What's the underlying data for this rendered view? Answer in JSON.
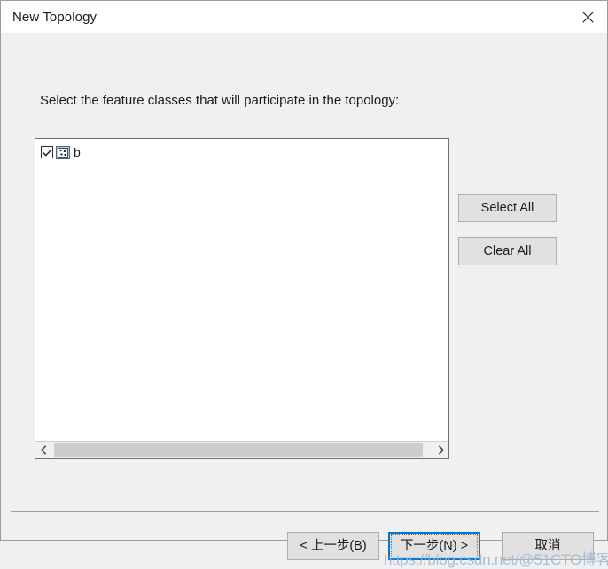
{
  "window": {
    "title": "New Topology",
    "close_icon": "close-icon"
  },
  "main": {
    "instruction": "Select the feature classes that will participate in the topology:",
    "list": {
      "items": [
        {
          "label": "b",
          "checked": true,
          "icon": "feature-class-point-icon"
        }
      ],
      "scrollbar": {
        "left_arrow": "chevron-left-icon",
        "right_arrow": "chevron-right-icon"
      }
    },
    "side_buttons": [
      {
        "label": "Select All",
        "name": "select-all-button"
      },
      {
        "label": "Clear All",
        "name": "clear-all-button"
      }
    ]
  },
  "footer": {
    "back_label": "< 上一步(B)",
    "next_label": "下一步(N) >",
    "cancel_label": "取消"
  },
  "watermark": {
    "text": "https://blog.csdn.net/@51CTO博客"
  },
  "colors": {
    "accent": "#0078d7",
    "dialog_bg": "#f0f0f0",
    "button_bg": "#e1e1e1",
    "list_bg": "#ffffff",
    "border": "#6e7079"
  }
}
